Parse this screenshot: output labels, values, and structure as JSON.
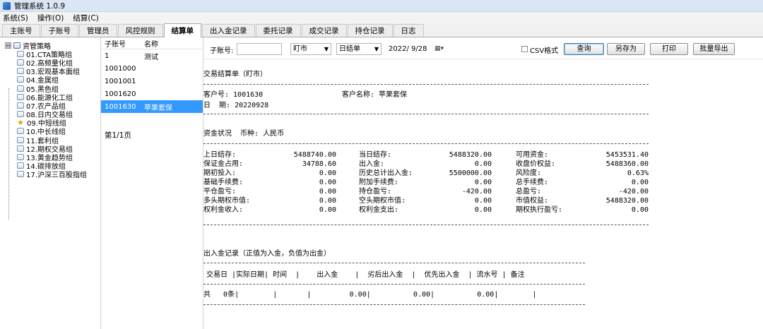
{
  "window": {
    "title": "管理系统 1.0.9"
  },
  "menu": [
    "系统(S)",
    "操作(O)",
    "结算(C)"
  ],
  "tabs": [
    "主账号",
    "子账号",
    "管理员",
    "风控规则",
    "结算单",
    "出入金记录",
    "委托记录",
    "成交记录",
    "持仓记录",
    "日志"
  ],
  "tree": {
    "root": "资管策略",
    "expander": "⊟",
    "items": [
      "01.CTA策略组",
      "02.高频量化组",
      "03.宏观基本面组",
      "04.金属组",
      "05.黑色组",
      "06.能源化工组",
      "07.农产品组",
      "08.日内交易组",
      "09.中短线组",
      "10.中长线组",
      "11.套利组",
      "12.期权交易组",
      "13.黄金趋势组",
      "14.碳排放组",
      "17.沪深三百股指组"
    ]
  },
  "accounts": {
    "headers": [
      "子账号",
      "名称"
    ],
    "rows": [
      {
        "id": "1",
        "name": "测试"
      },
      {
        "id": "1001000",
        "name": ""
      },
      {
        "id": "1001001",
        "name": ""
      },
      {
        "id": "1001620",
        "name": ""
      },
      {
        "id": "1001630",
        "name": "苹果套保"
      }
    ],
    "selected_index": 4,
    "page_info": "第1/1页"
  },
  "toolbar": {
    "sub_account_label": "子账号:",
    "sub_account_value": "",
    "market_select": "盯市",
    "period_select": "日结单",
    "date": "2022/ 9/28",
    "csv_label": "CSV格式",
    "csv_checked": false,
    "buttons": [
      "查询",
      "另存为",
      "打印",
      "批量导出"
    ]
  },
  "report": {
    "title": "交易结算单（盯市）",
    "client_no": "客户号: 1001630",
    "client_name": "客户名称: 苹果套保",
    "date": "日  期: 20220928",
    "fund_status": "资金状况  币种: 人民币",
    "fund_rows": [
      [
        [
          "上日结存:",
          "5488740.00"
        ],
        [
          "当日结存:",
          "5488320.00"
        ],
        [
          "可用资金:",
          "5453531.40"
        ]
      ],
      [
        [
          "保证金占用:",
          "34788.60"
        ],
        [
          "出入金:",
          "0.00"
        ],
        [
          "收盘价权益:",
          "5488360.00"
        ]
      ],
      [
        [
          "期初投入:",
          "0.00"
        ],
        [
          "历史总计出入金:",
          "5500000.00"
        ],
        [
          "风险度:",
          "0.63%"
        ]
      ],
      [
        [
          "基础手续费:",
          "0.00"
        ],
        [
          "附加手续费:",
          "0.00"
        ],
        [
          "总手续费:",
          "0.00"
        ]
      ],
      [
        [
          "平仓盈亏:",
          "0.00"
        ],
        [
          "持仓盈亏:",
          "-420.00"
        ],
        [
          "总盈亏:",
          "-420.00"
        ]
      ],
      [
        [
          "多头期权市值:",
          "0.00"
        ],
        [
          "空头期权市值:",
          "0.00"
        ],
        [
          "市值权益:",
          "5488320.00"
        ]
      ],
      [
        [
          "权利金收入:",
          "0.00"
        ],
        [
          "权利金支出:",
          "0.00"
        ],
        [
          "期权执行盈亏:",
          "0.00"
        ]
      ]
    ],
    "io_title": "出入金记录（正值为入金，负值为出金）",
    "io_header": "交易日 |实际日期| 时间  |    出入金    |  劣后出入金  |  优先出入金  | 流水号 | 备注",
    "io_row": "共   0条|        |       |         0.00|          0.00|          0.00|        |"
  }
}
